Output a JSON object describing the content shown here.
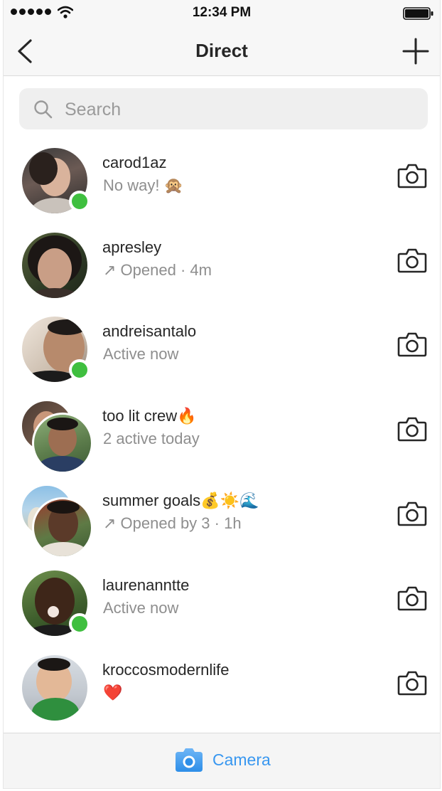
{
  "status_bar": {
    "time": "12:34 PM"
  },
  "header": {
    "title": "Direct"
  },
  "search": {
    "placeholder": "Search"
  },
  "threads": [
    {
      "username": "carod1az",
      "preview": "No way! 🙊",
      "online": true
    },
    {
      "username": "apresley",
      "preview": "↗ Opened · 4m",
      "online": false
    },
    {
      "username": "andreisantalo",
      "preview": "Active now",
      "online": true
    },
    {
      "username": "too lit crew🔥",
      "preview": "2 active today",
      "online": false
    },
    {
      "username": "summer goals💰☀️🌊",
      "preview": "↗ Opened by 3 · 1h",
      "online": false
    },
    {
      "username": "laurenanntte",
      "preview": "Active now",
      "online": true
    },
    {
      "username": "kroccosmodernlife",
      "preview": "❤️",
      "online": false
    }
  ],
  "bottom_bar": {
    "camera_label": "Camera"
  },
  "colors": {
    "online": "#3fbf3f",
    "accent": "#3897f0",
    "heart": "#ed4956"
  },
  "icons": {
    "back": "chevron-left-icon",
    "new_message": "plus-icon",
    "search": "search-icon",
    "thread_camera": "camera-icon",
    "bottom_camera": "camera-icon"
  }
}
